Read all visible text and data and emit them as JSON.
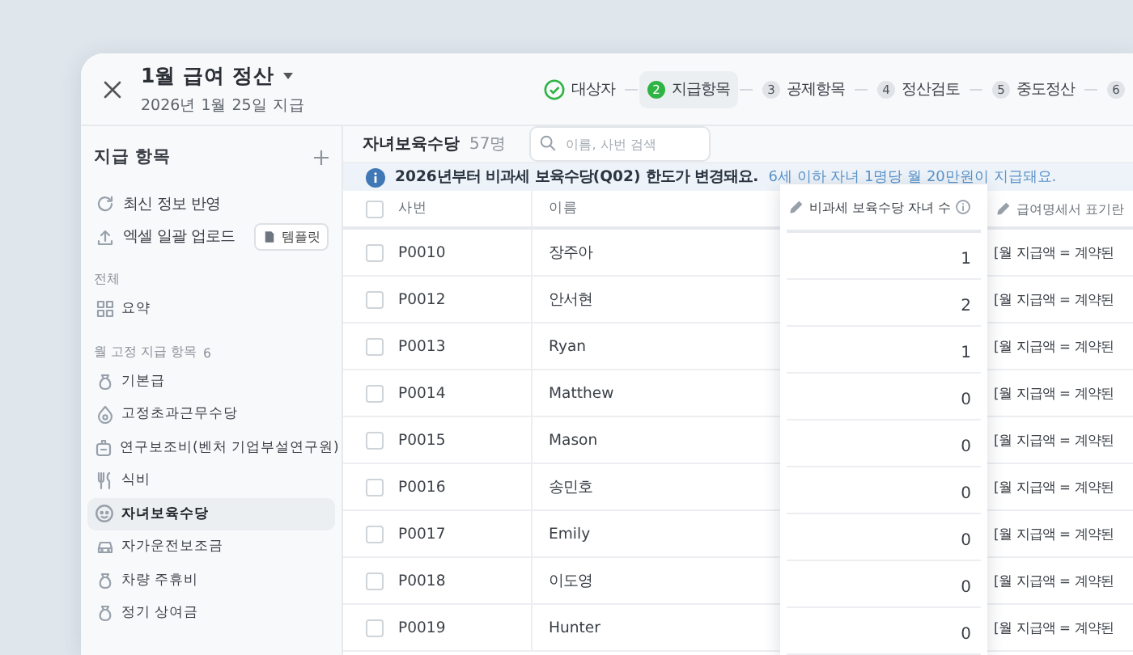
{
  "window": {
    "title": "1월 급여 정산",
    "subtitle": "2026년 1월 25일 지급"
  },
  "steps": [
    {
      "label": "대상자",
      "completed": true,
      "selected": false
    },
    {
      "number": "2",
      "label": "지급항목",
      "completed": false,
      "selected": true
    },
    {
      "number": "3",
      "label": "공제항목",
      "completed": false,
      "selected": false
    },
    {
      "number": "4",
      "label": "정산검토",
      "completed": false,
      "selected": false
    },
    {
      "number": "5",
      "label": "중도정산",
      "completed": false,
      "selected": false
    },
    {
      "number": "6",
      "completed": false,
      "selected": false
    }
  ],
  "sidebar": {
    "title": "지급 항목",
    "actions": [
      {
        "label": "최신 정보 반영"
      },
      {
        "label": "엑셀 일괄 업로드",
        "button": "템플릿"
      }
    ],
    "sections": [
      {
        "label": "전체",
        "items": [
          {
            "label": "요약",
            "selected": false
          }
        ]
      },
      {
        "label": "월 고정 지급 항목",
        "count": "6",
        "items": [
          {
            "label": "기본급",
            "selected": false
          },
          {
            "label": "고정초과근무수당",
            "selected": false
          },
          {
            "label": "연구보조비(벤처 기업부설연구원)",
            "selected": false
          },
          {
            "label": "식비",
            "selected": false
          },
          {
            "label": "자녀보육수당",
            "selected": true
          },
          {
            "label": "자가운전보조금",
            "selected": false
          },
          {
            "label": "차량 주휴비",
            "selected": false
          },
          {
            "label": "정기 상여금",
            "selected": false
          }
        ]
      }
    ]
  },
  "toolbar": {
    "title": "자녀보육수당",
    "count": "57명",
    "search": {
      "placeholder": "이름, 사번 검색"
    }
  },
  "notice": {
    "text": "2026년부터 비과세 보육수당(Q02) 한도가 변경돼요.",
    "detail": "6세 이하 자녀 1명당 월 20만원이 지급돼요."
  },
  "table": {
    "all_checked": false,
    "columns": [
      "사번",
      "이름",
      "비과세 보육수당 자녀 수",
      "급여명세서 표기란"
    ],
    "rows": [
      {
        "checked": false,
        "id": "P0010",
        "name": "장주아",
        "children": "1",
        "payslip": "[월 지급액 = 계약된"
      },
      {
        "checked": false,
        "id": "P0012",
        "name": "안서현",
        "children": "2",
        "payslip": "[월 지급액 = 계약된"
      },
      {
        "checked": false,
        "id": "P0013",
        "name": "Ryan",
        "children": "1",
        "payslip": "[월 지급액 = 계약된"
      },
      {
        "checked": false,
        "id": "P0014",
        "name": "Matthew",
        "children": "0",
        "payslip": "[월 지급액 = 계약된"
      },
      {
        "checked": false,
        "id": "P0015",
        "name": "Mason",
        "children": "0",
        "payslip": "[월 지급액 = 계약된"
      },
      {
        "checked": false,
        "id": "P0016",
        "name": "송민호",
        "children": "0",
        "payslip": "[월 지급액 = 계약된"
      },
      {
        "checked": false,
        "id": "P0017",
        "name": "Emily",
        "children": "0",
        "payslip": "[월 지급액 = 계약된"
      },
      {
        "checked": false,
        "id": "P0018",
        "name": "이도영",
        "children": "0",
        "payslip": "[월 지급액 = 계약된"
      },
      {
        "checked": false,
        "id": "P0019",
        "name": "Hunter",
        "children": "0",
        "payslip": "[월 지급액 = 계약된"
      }
    ]
  }
}
